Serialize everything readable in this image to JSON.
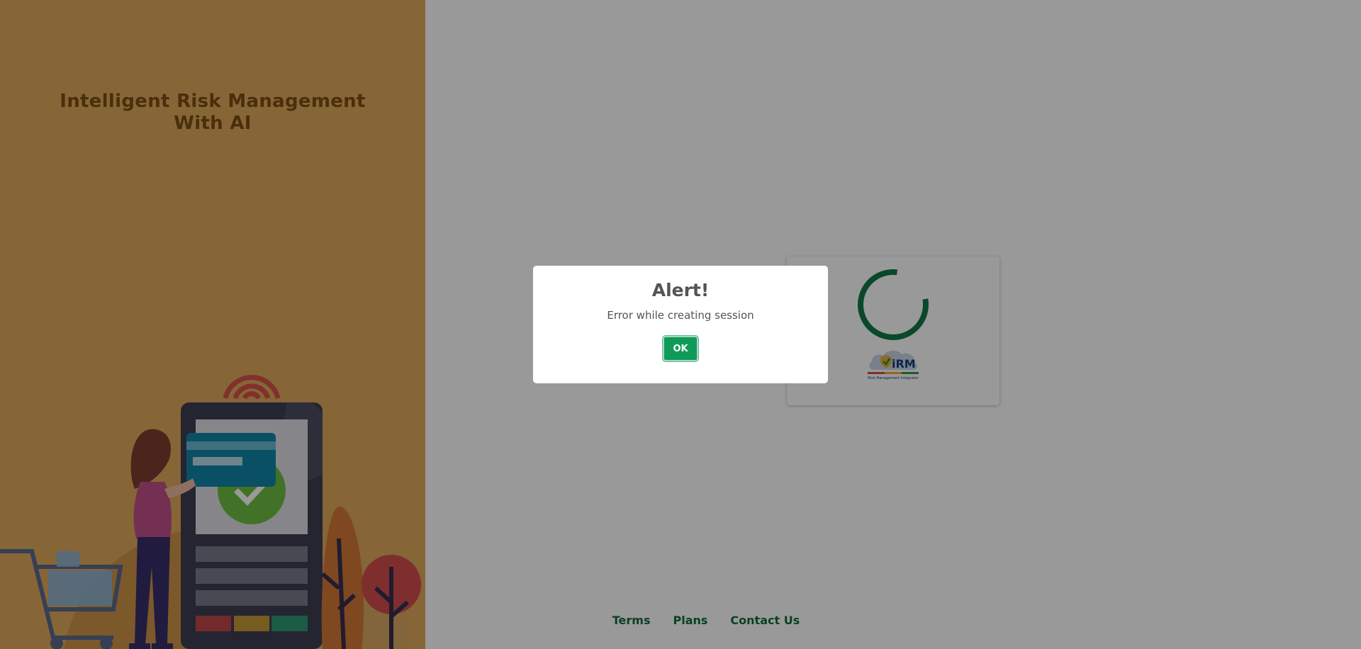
{
  "left": {
    "title_line1": "Intelligent Risk Management",
    "title_line2": "With AI"
  },
  "loader": {
    "logo_text": "iRM",
    "logo_tagline": "Risk Management Integrator"
  },
  "footer": {
    "links": [
      "Terms",
      "Plans",
      "Contact Us"
    ]
  },
  "modal": {
    "title": "Alert!",
    "message": "Error while creating session",
    "ok_label": "OK"
  },
  "colors": {
    "left_bg": "#dfa85c",
    "brand_green": "#126b3c",
    "ok_button": "#0f9b57",
    "spinner": "#0f7a45"
  },
  "icons": [
    "spinner-icon",
    "irm-logo",
    "shopping-cart-icon",
    "credit-card-icon",
    "checkmark-icon",
    "wifi-signal-icon"
  ]
}
